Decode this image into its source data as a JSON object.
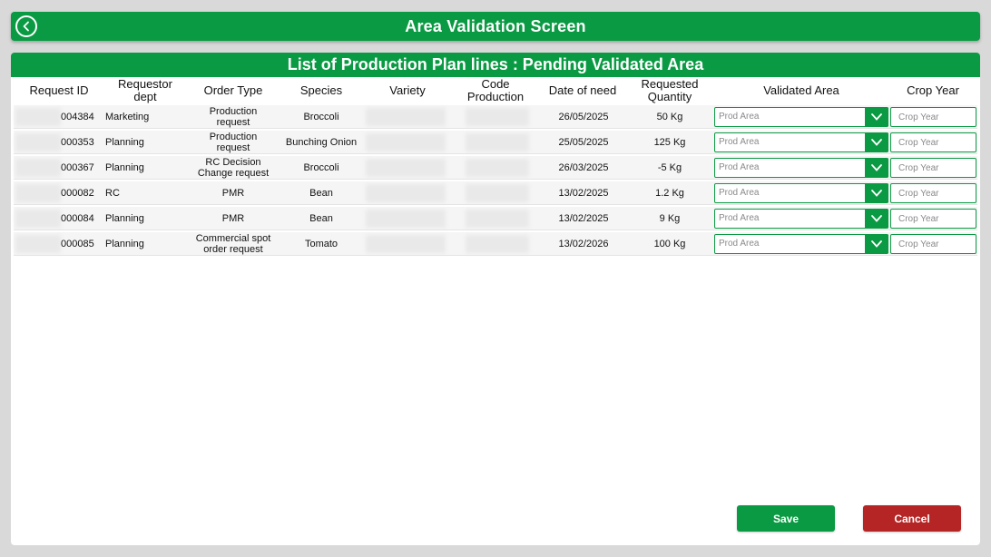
{
  "header": {
    "title": "Area Validation Screen",
    "back_icon": "chevron-left-icon"
  },
  "panel": {
    "title": "List of Production Plan lines : Pending Validated Area"
  },
  "columns": {
    "request_id": "Request ID",
    "requestor_dept": "Requestor dept",
    "order_type": "Order Type",
    "species": "Species",
    "variety": "Variety",
    "code_production": "Code Production",
    "date_of_need": "Date of need",
    "requested_quantity": "Requested Quantity",
    "validated_area": "Validated Area",
    "crop_year": "Crop Year"
  },
  "rows": [
    {
      "request_id": "004384",
      "dept": "Marketing",
      "order_type": "Production request",
      "species": "Broccoli",
      "date": "26/05/2025",
      "quantity": "50 Kg"
    },
    {
      "request_id": "000353",
      "dept": "Planning",
      "order_type": "Production request",
      "species": "Bunching Onion",
      "date": "25/05/2025",
      "quantity": "125 Kg"
    },
    {
      "request_id": "000367",
      "dept": "Planning",
      "order_type": "RC Decision Change request",
      "species": "Broccoli",
      "date": "26/03/2025",
      "quantity": "-5 Kg"
    },
    {
      "request_id": "000082",
      "dept": "RC",
      "order_type": "PMR",
      "species": "Bean",
      "date": "13/02/2025",
      "quantity": "1.2 Kg"
    },
    {
      "request_id": "000084",
      "dept": "Planning",
      "order_type": "PMR",
      "species": "Bean",
      "date": "13/02/2025",
      "quantity": "9 Kg"
    },
    {
      "request_id": "000085",
      "dept": "Planning",
      "order_type": "Commercial spot order request",
      "species": "Tomato",
      "date": "13/02/2026",
      "quantity": "100 Kg"
    }
  ],
  "inputs": {
    "prod_area_placeholder": "Prod Area",
    "crop_year_placeholder": "Crop Year",
    "dropdown_icon": "chevron-down-icon"
  },
  "buttons": {
    "save": "Save",
    "cancel": "Cancel"
  },
  "colors": {
    "primary_green": "#0a9a43",
    "cancel_red": "#b52525",
    "background": "#d9d9d9"
  }
}
